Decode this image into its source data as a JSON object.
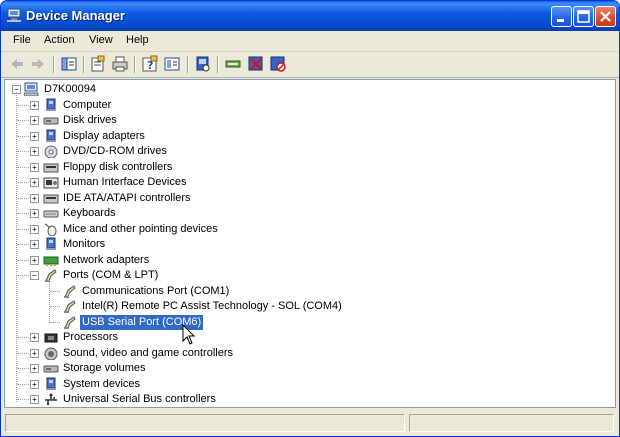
{
  "window": {
    "title": "Device Manager"
  },
  "menu": [
    "File",
    "Action",
    "View",
    "Help"
  ],
  "toolbar": {
    "buttons": [
      "back-icon",
      "forward-icon",
      "show-hide-tree-icon",
      "properties-icon",
      "print-icon",
      "help-icon",
      "view-icon",
      "scan-hardware-icon",
      "update-driver-icon",
      "uninstall-icon",
      "disable-icon"
    ]
  },
  "tree": {
    "root": "D7K00094",
    "categories": [
      {
        "label": "Computer",
        "icon": "computer-icon"
      },
      {
        "label": "Disk drives",
        "icon": "disk-drive-icon"
      },
      {
        "label": "Display adapters",
        "icon": "display-adapter-icon"
      },
      {
        "label": "DVD/CD-ROM drives",
        "icon": "dvd-drive-icon"
      },
      {
        "label": "Floppy disk controllers",
        "icon": "floppy-controller-icon"
      },
      {
        "label": "Human Interface Devices",
        "icon": "hid-icon"
      },
      {
        "label": "IDE ATA/ATAPI controllers",
        "icon": "ide-controller-icon"
      },
      {
        "label": "Keyboards",
        "icon": "keyboard-icon"
      },
      {
        "label": "Mice and other pointing devices",
        "icon": "mouse-icon"
      },
      {
        "label": "Monitors",
        "icon": "monitor-icon"
      },
      {
        "label": "Network adapters",
        "icon": "network-adapter-icon"
      },
      {
        "label": "Ports (COM & LPT)",
        "icon": "port-icon",
        "expanded": true
      },
      {
        "label": "Processors",
        "icon": "processor-icon"
      },
      {
        "label": "Sound, video and game controllers",
        "icon": "sound-icon"
      },
      {
        "label": "Storage volumes",
        "icon": "storage-icon"
      },
      {
        "label": "System devices",
        "icon": "system-devices-icon"
      },
      {
        "label": "Universal Serial Bus controllers",
        "icon": "usb-icon"
      }
    ],
    "ports_children": [
      {
        "label": "Communications Port (COM1)"
      },
      {
        "label": "Intel(R) Remote PC Assist Technology - SOL (COM4)"
      },
      {
        "label": "USB Serial Port (COM6)",
        "selected": true
      }
    ]
  },
  "colors": {
    "title_bar": "#0B5BE0",
    "selection": "#316AC5",
    "window_bg": "#ECE9D8"
  }
}
